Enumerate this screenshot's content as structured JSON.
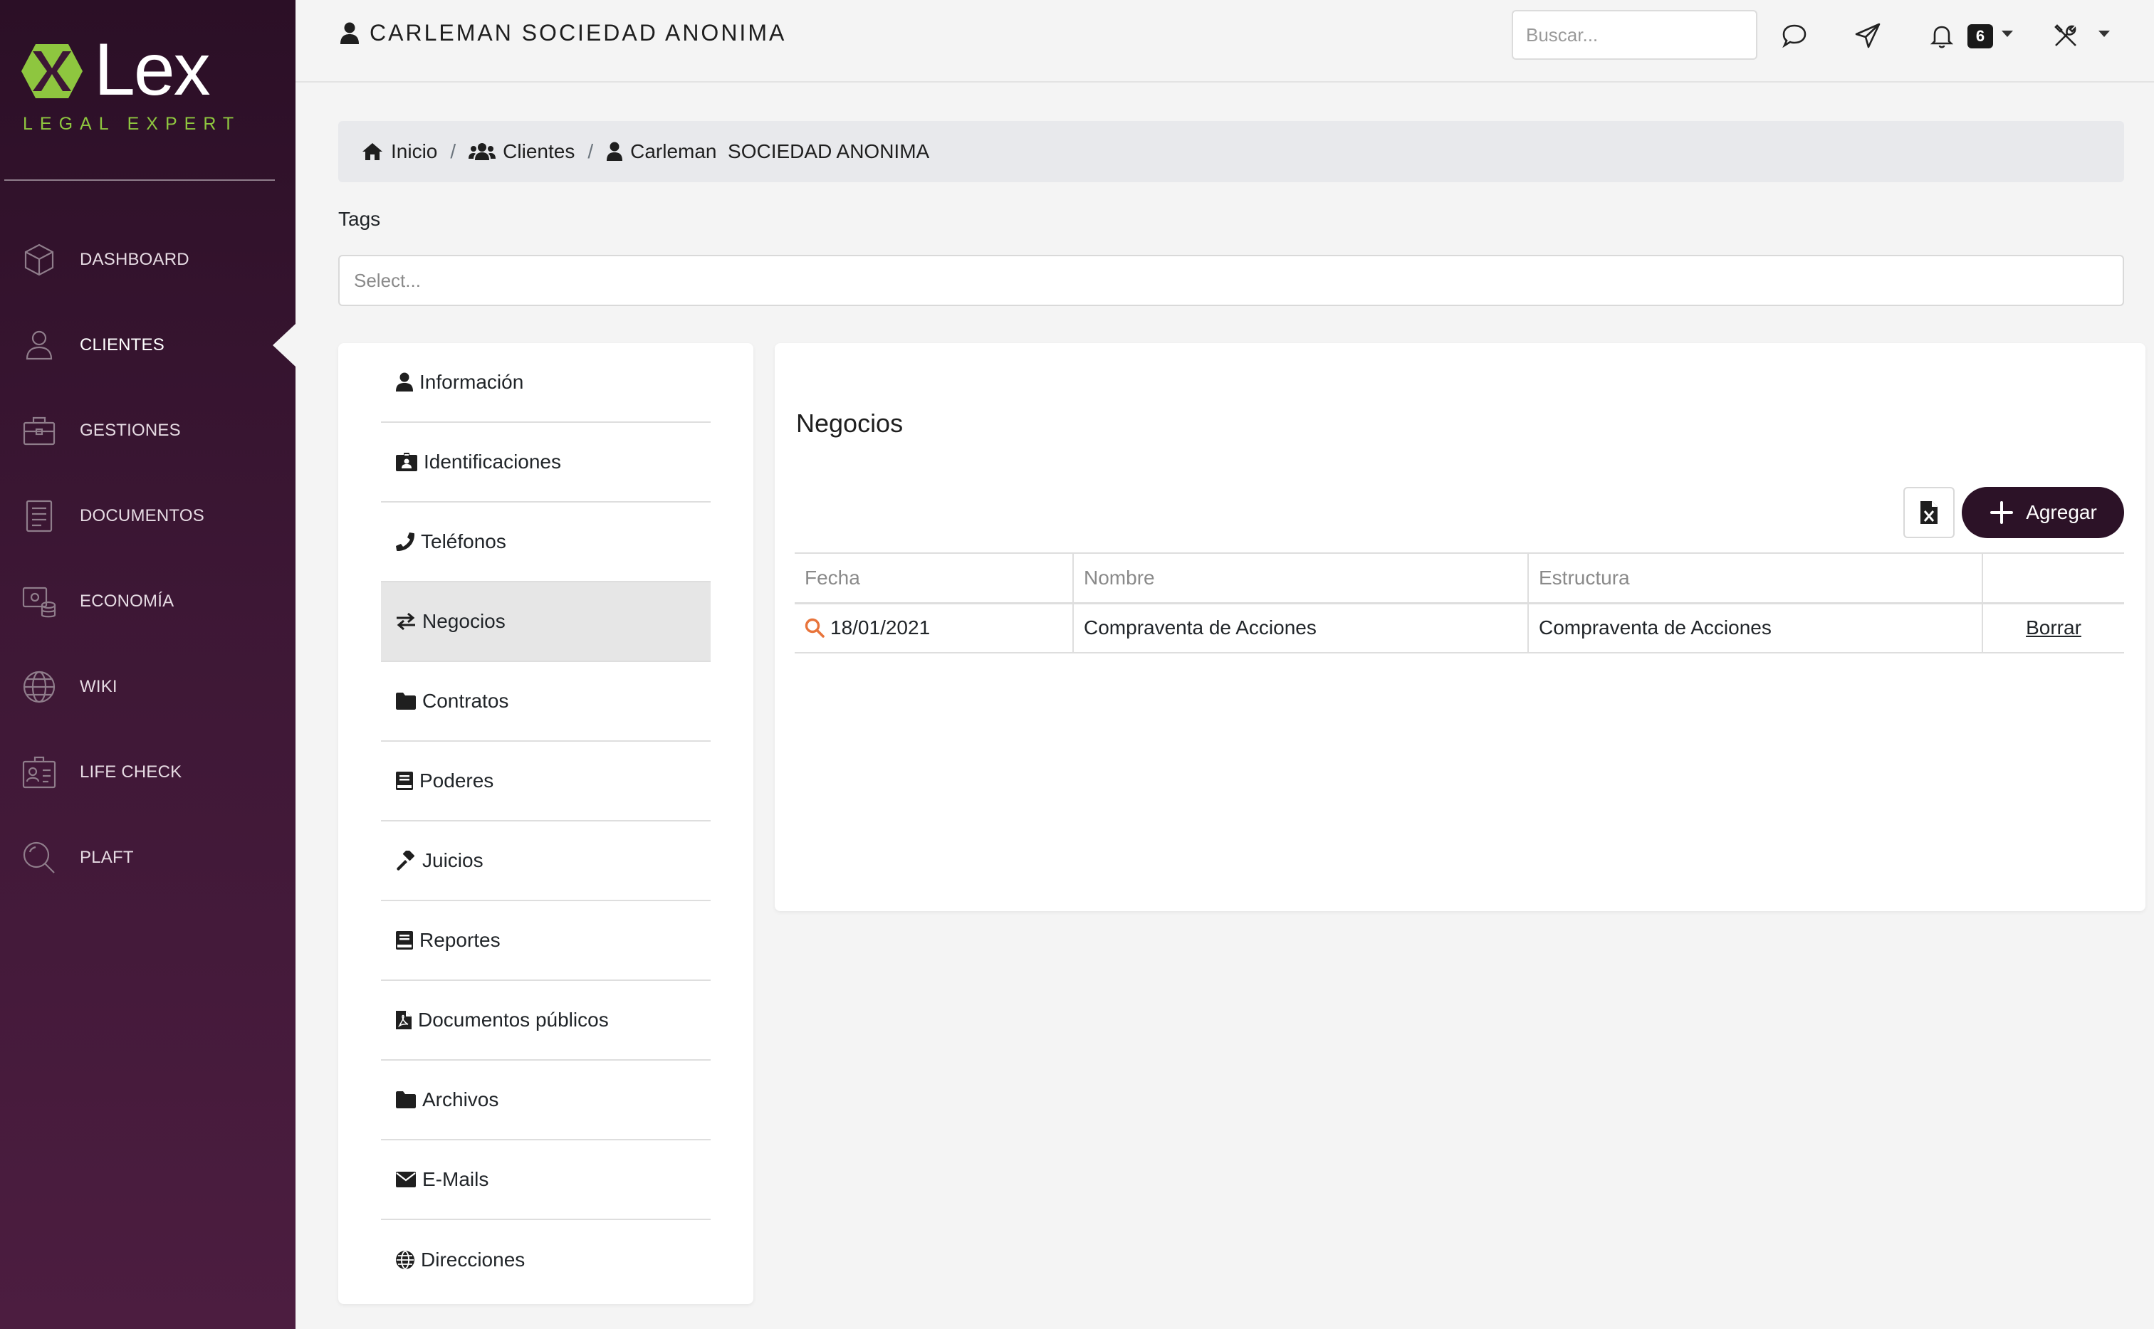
{
  "brand": {
    "name": "Lex",
    "subtitle": "LEGAL EXPERT",
    "accent_color": "#8ec63f",
    "sidebar_color": "#3d1735"
  },
  "sidebar": {
    "items": [
      {
        "label": "DASHBOARD",
        "icon": "cube-icon",
        "active": false
      },
      {
        "label": "CLIENTES",
        "icon": "user-icon",
        "active": true
      },
      {
        "label": "GESTIONES",
        "icon": "briefcase-icon",
        "active": false
      },
      {
        "label": "DOCUMENTOS",
        "icon": "document-icon",
        "active": false
      },
      {
        "label": "ECONOMÍA",
        "icon": "money-icon",
        "active": false
      },
      {
        "label": "WIKI",
        "icon": "globe-icon",
        "active": false
      },
      {
        "label": "LIFE CHECK",
        "icon": "id-card-icon",
        "active": false
      },
      {
        "label": "PLAFT",
        "icon": "magnifier-icon",
        "active": false
      }
    ]
  },
  "header": {
    "client_name": "CARLEMAN SOCIEDAD ANONIMA",
    "search_placeholder": "Buscar...",
    "notifications_count": "6"
  },
  "breadcrumb": {
    "home": "Inicio",
    "clients": "Clientes",
    "current": "Carleman  SOCIEDAD ANONIMA"
  },
  "tags": {
    "label": "Tags",
    "placeholder": "Select..."
  },
  "tabs": [
    {
      "label": "Información",
      "icon": "user-icon"
    },
    {
      "label": "Identificaciones",
      "icon": "id-badge-icon"
    },
    {
      "label": "Teléfonos",
      "icon": "phone-icon"
    },
    {
      "label": "Negocios",
      "icon": "exchange-icon",
      "active": true
    },
    {
      "label": "Contratos",
      "icon": "folder-icon"
    },
    {
      "label": "Poderes",
      "icon": "book-icon"
    },
    {
      "label": "Juicios",
      "icon": "gavel-icon"
    },
    {
      "label": "Reportes",
      "icon": "book-icon"
    },
    {
      "label": "Documentos públicos",
      "icon": "pdf-file-icon"
    },
    {
      "label": "Archivos",
      "icon": "folder-icon"
    },
    {
      "label": "E-Mails",
      "icon": "envelope-icon"
    },
    {
      "label": "Direcciones",
      "icon": "globe-icon"
    }
  ],
  "negocios": {
    "title": "Negocios",
    "add_label": "Agregar",
    "columns": [
      "Fecha",
      "Nombre",
      "Estructura",
      ""
    ],
    "rows": [
      {
        "fecha": "18/01/2021",
        "nombre": "Compraventa de Acciones",
        "estructura": "Compraventa de Acciones",
        "action": "Borrar"
      }
    ]
  }
}
